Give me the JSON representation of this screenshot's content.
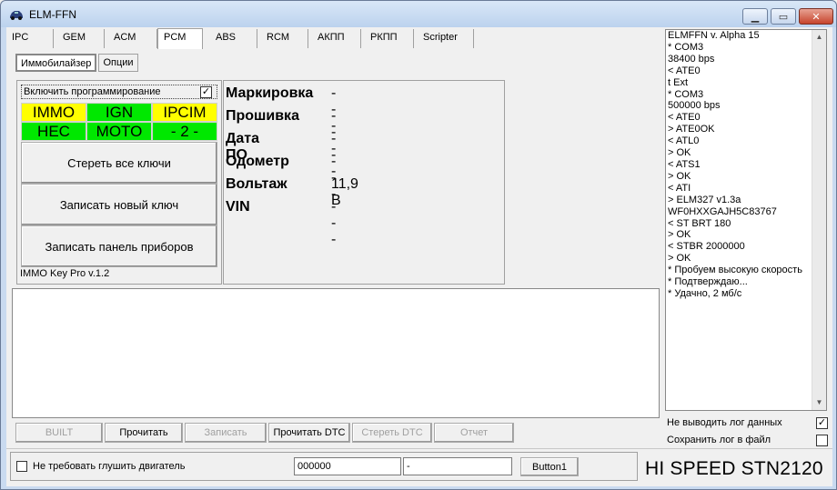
{
  "window": {
    "title": "ELM-FFN"
  },
  "tabs": [
    "IPC",
    "GEM",
    "ACM",
    "PCM",
    "ABS",
    "RCM",
    "АКПП",
    "РКПП",
    "Scripter"
  ],
  "active_tab": "PCM",
  "subtabs": [
    "Иммобилайзер",
    "Опции"
  ],
  "immo_panel": {
    "enable_label": "Включить программирование",
    "enable_checked": "✓",
    "grid": [
      [
        "IMMO",
        "IGN",
        "IPCIM"
      ],
      [
        "HEC",
        "MOTO",
        "- 2 -"
      ]
    ],
    "buttons": [
      "Стереть все ключи",
      "Записать новый ключ",
      "Записать панель приборов"
    ],
    "version": "IMMO Key Pro v.1.2"
  },
  "info": [
    {
      "label": "Маркировка",
      "value": "- - -"
    },
    {
      "label": "Прошивка",
      "value": "- - -"
    },
    {
      "label": "Дата ПО",
      "value": "- - -"
    },
    {
      "label": "Одометр",
      "value": "- - -"
    },
    {
      "label": "Вольтаж",
      "value": "11,9 В"
    },
    {
      "label": "VIN",
      "value": "- - -"
    }
  ],
  "buttonbar": [
    {
      "label": "BUILT",
      "enabled": false
    },
    {
      "label": "Прочитать",
      "enabled": true
    },
    {
      "label": "Записать",
      "enabled": false
    },
    {
      "label": "Прочитать DTC",
      "enabled": true
    },
    {
      "label": "Стереть DTC",
      "enabled": false
    },
    {
      "label": "Отчет",
      "enabled": false
    }
  ],
  "log_lines": [
    "ELMFFN v. Alpha 15",
    "* COM3",
    "38400 bps",
    "< ATE0",
    "t Ext",
    "* COM3",
    "500000 bps",
    "< ATE0",
    "> ATE0OK",
    "< ATL0",
    "> OK",
    "< ATS1",
    "> OK",
    "< ATI",
    "> ELM327 v1.3a",
    "WF0HXXGAJH5C83767",
    "< ST BRT 180",
    "> OK",
    "< STBR 2000000",
    "> OK",
    "* Пробуем высокую скорость",
    "* Подтверждаю...",
    "* Удачно, 2 мб/с"
  ],
  "log_options": [
    {
      "label": "Не выводить лог данных",
      "checked": "✓"
    },
    {
      "label": "Сохранить лог в файл",
      "checked": ""
    }
  ],
  "bottom": {
    "engine_label": "Не требовать глушить двигатель",
    "input1": "000000",
    "input2": "-",
    "button1": "Button1",
    "brand": "HI SPEED STN2120"
  }
}
